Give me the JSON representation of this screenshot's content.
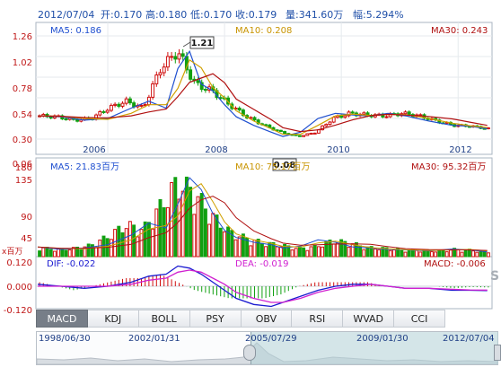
{
  "header": {
    "date": "2012/07/04",
    "open": "开:0.170",
    "high": "高:0.180",
    "low": "低:0.170",
    "close": "收:0.179",
    "volume": "量:341.60万",
    "amplitude": "幅:5.294%"
  },
  "price_panel": {
    "ma5_label": "MA5: 0.186",
    "ma10_label": "MA10: 0.208",
    "ma30_label": "MA30: 0.243",
    "peak_label": "1.21",
    "trough_label": "0.08",
    "y_ticks": [
      "1.26",
      "1.02",
      "0.78",
      "0.54",
      "0.30",
      "0.06"
    ],
    "x_ticks": [
      "2006",
      "2008",
      "2010",
      "2012"
    ]
  },
  "volume_panel": {
    "ma5_label": "MA5: 21.83百万",
    "ma10_label": "MA10: 75.17百万",
    "ma30_label": "MA30: 95.32百万",
    "y_ticks": [
      "180",
      "135",
      "90",
      "45"
    ],
    "unit_label": "x百万"
  },
  "macd_panel": {
    "dif_label": "DIF: -0.022",
    "dea_label": "DEA: -0.019",
    "macd_label": "MACD: -0.006",
    "y_ticks": [
      "0.120",
      "0.000",
      "-0.120"
    ]
  },
  "tabs": [
    {
      "label": "MACD",
      "active": true
    },
    {
      "label": "KDJ",
      "active": false
    },
    {
      "label": "BOLL",
      "active": false
    },
    {
      "label": "PSY",
      "active": false
    },
    {
      "label": "OBV",
      "active": false
    },
    {
      "label": "RSI",
      "active": false
    },
    {
      "label": "WVAD",
      "active": false
    },
    {
      "label": "CCI",
      "active": false
    }
  ],
  "navigator": {
    "dates": [
      "1998/06/30",
      "2002/01/31",
      "2005/07/29",
      "2009/01/30",
      "2012/07/04"
    ]
  },
  "colors": {
    "up": "#d01010",
    "down": "#11a011",
    "ma5": "#1f4fd0",
    "ma10": "#d0a000",
    "ma30": "#b01010",
    "dif": "#1a1ad0",
    "dea": "#d020d0",
    "panel_border": "#aab4c0"
  },
  "chart_data": {
    "type": "candlestick",
    "title": "",
    "x_ticks": [
      "2006",
      "2008",
      "2010",
      "2012"
    ],
    "price": {
      "ylim": [
        0.06,
        1.26
      ],
      "x": [
        2004.8,
        2005.2,
        2005.6,
        2006.0,
        2006.4,
        2006.7,
        2007.0,
        2007.2,
        2007.4,
        2007.6,
        2007.8,
        2008.0,
        2008.2,
        2008.5,
        2008.8,
        2009.0,
        2009.3,
        2009.6,
        2009.9,
        2010.2,
        2010.5,
        2010.8,
        2011.1,
        2011.5,
        2011.9,
        2012.2,
        2012.5
      ],
      "close": [
        0.33,
        0.32,
        0.28,
        0.3,
        0.42,
        0.5,
        0.42,
        0.88,
        1.08,
        0.7,
        0.62,
        0.46,
        0.32,
        0.22,
        0.14,
        0.09,
        0.14,
        0.3,
        0.36,
        0.34,
        0.33,
        0.36,
        0.33,
        0.27,
        0.22,
        0.21,
        0.18
      ],
      "peak": 1.21,
      "trough": 0.08
    },
    "volume": {
      "ylim": [
        0,
        180
      ],
      "values": [
        20,
        15,
        18,
        25,
        45,
        70,
        60,
        110,
        165,
        140,
        90,
        55,
        40,
        30,
        25,
        18,
        22,
        35,
        30,
        20,
        18,
        15,
        14,
        12,
        16,
        14,
        10
      ]
    },
    "macd": {
      "ylim": [
        -0.12,
        0.12
      ],
      "dif": [
        0.01,
        0.0,
        -0.01,
        0.0,
        0.02,
        0.05,
        0.06,
        0.1,
        0.09,
        0.06,
        0.02,
        -0.02,
        -0.06,
        -0.09,
        -0.1,
        -0.08,
        -0.05,
        -0.02,
        0.0,
        0.01,
        0.01,
        0.0,
        -0.01,
        -0.01,
        -0.02,
        -0.02,
        -0.022
      ],
      "dea": [
        0.0,
        0.0,
        0.0,
        0.0,
        0.01,
        0.03,
        0.04,
        0.07,
        0.08,
        0.07,
        0.04,
        0.01,
        -0.03,
        -0.06,
        -0.08,
        -0.08,
        -0.06,
        -0.03,
        -0.01,
        0.0,
        0.01,
        0.0,
        -0.01,
        -0.01,
        -0.015,
        -0.018,
        -0.019
      ]
    }
  }
}
